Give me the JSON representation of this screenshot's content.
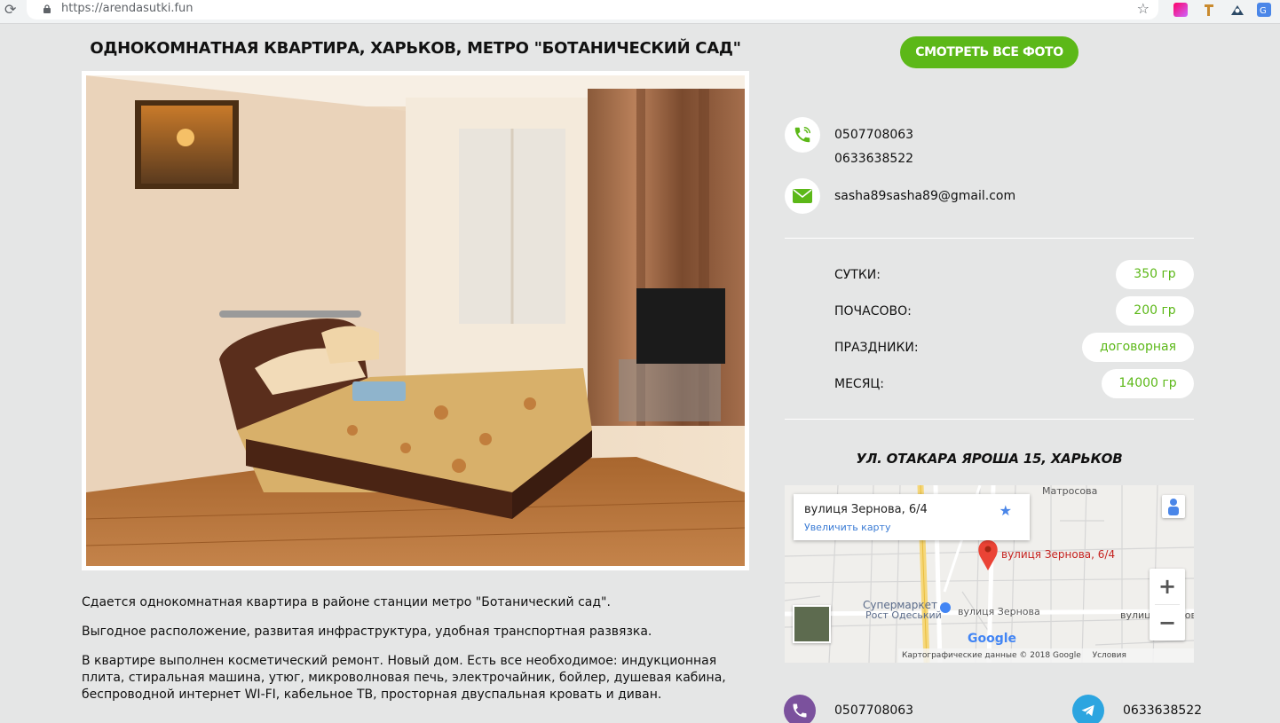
{
  "browser": {
    "url": "https://arendasutki.fun"
  },
  "listing": {
    "title": "ОДНОКОМНАТНАЯ КВАРТИРА, ХАРЬКОВ, МЕТРО \"БОТАНИЧЕСКИЙ САД\"",
    "description": [
      "Сдается однокомнатная квартира в районе станции метро \"Ботанический сад\".",
      "Выгодное расположение, развитая инфраструктура, удобная транспортная развязка.",
      "В квартире выполнен косметический ремонт. Новый дом. Есть все необходимое: индукционная плита, стиральная машина, утюг, микроволновая печь, электрочайник, бойлер, душевая кабина, беспроводной интернет WI-FI, кабельное ТВ, просторная двуспальная кровать и диван."
    ]
  },
  "gallery": {
    "button_label": "СМОТРЕТЬ ВСЕ ФОТО"
  },
  "contacts": {
    "phone_1": "0507708063",
    "phone_2": "0633638522",
    "email": "sasha89sasha89@gmail.com"
  },
  "prices": [
    {
      "label": "СУТКИ:",
      "value": "350 гр"
    },
    {
      "label": "ПОЧАСОВО:",
      "value": "200 гр"
    },
    {
      "label": "ПРАЗДНИКИ:",
      "value": "договорная"
    },
    {
      "label": "МЕСЯЦ:",
      "value": "14000 гр"
    }
  ],
  "location": {
    "address": "УЛ. ОТАКАРА ЯРОША 15, ХАРЬКОВ"
  },
  "map": {
    "info_title": "вулиця Зернова, 6/4",
    "info_link": "Увеличить карту",
    "pin_label": "вулиця Зернова, 6/4",
    "street_labels": [
      "Матросова",
      "Супермаркет",
      "Рост Одеський",
      "вулиця Зернова",
      "вулиця Зернова"
    ],
    "attribution": "Картографические данные © 2018 Google",
    "terms": "Условия использования",
    "logo": "Google"
  },
  "messengers": {
    "viber_phone": "0507708063",
    "telegram_phone": "0633638522"
  },
  "colors": {
    "accent": "#5cb818",
    "background": "#e5e6e6",
    "viber": "#7b519d",
    "telegram": "#2ca5e0"
  },
  "icons": {
    "phone": "phone-icon",
    "email": "envelope-icon",
    "viber": "viber-icon",
    "telegram": "telegram-icon"
  }
}
